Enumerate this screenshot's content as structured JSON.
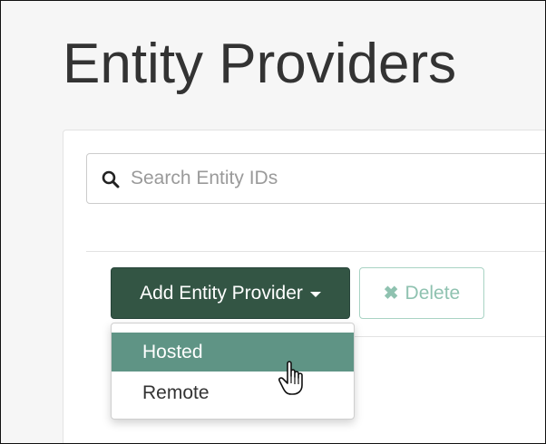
{
  "header": {
    "title": "Entity Providers"
  },
  "search": {
    "placeholder": "Search Entity IDs",
    "value": "",
    "icon": "search-icon"
  },
  "toolbar": {
    "add_label": "Add Entity Provider",
    "add_icon": "caret-down-icon",
    "delete_label": "Delete",
    "delete_icon": "close-icon"
  },
  "dropdown": {
    "items": [
      {
        "label": "Hosted",
        "state": "hovered"
      },
      {
        "label": "Remote",
        "state": "normal"
      }
    ]
  },
  "colors": {
    "primary_button": "#335544",
    "hover_item": "#5f9485",
    "delete_text": "#8fc2b0"
  }
}
